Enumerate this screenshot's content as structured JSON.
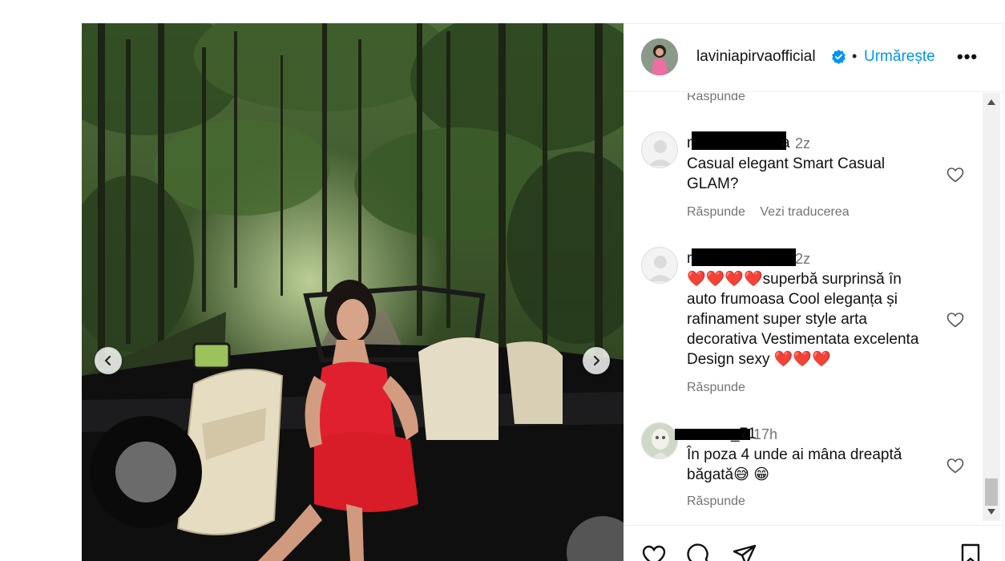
{
  "post": {
    "username": "laviniapirvaofficial",
    "separator": "•",
    "follow_label": "Urmărește",
    "more_label": "•••"
  },
  "comments": {
    "top_reply": "Răspunde",
    "items": [
      {
        "username_visible_start": "m",
        "username_visible_end": "a",
        "time": "2z",
        "text": "Casual elegant Smart Casual GLAM?",
        "actions": [
          "Răspunde",
          "Vezi traducerea"
        ]
      },
      {
        "username_visible_start": "m",
        "username_visible_end": "",
        "time": "2z",
        "text": "❤️❤️❤️❤️superbă surprinsă în auto frumoasa Cool eleganța și rafinament super style arta decorativa Vestimentata excelenta Design sexy ❤️❤️❤️",
        "actions": [
          "Răspunde"
        ]
      },
      {
        "username_visible_start": "",
        "username_visible_end": "_71",
        "time": "17h",
        "text": "În poza 4 unde ai mâna dreaptă băgată😅 😁",
        "actions": [
          "Răspunde"
        ]
      }
    ]
  },
  "icons": {
    "like": "heart-icon",
    "comment": "comment-icon",
    "share": "share-icon",
    "save": "bookmark-icon",
    "verified": "verified-badge-icon",
    "prev": "chevron-left-icon",
    "next": "chevron-right-icon"
  },
  "colors": {
    "accent": "#0095f6",
    "muted": "#737373",
    "dress": "#e0202e"
  }
}
